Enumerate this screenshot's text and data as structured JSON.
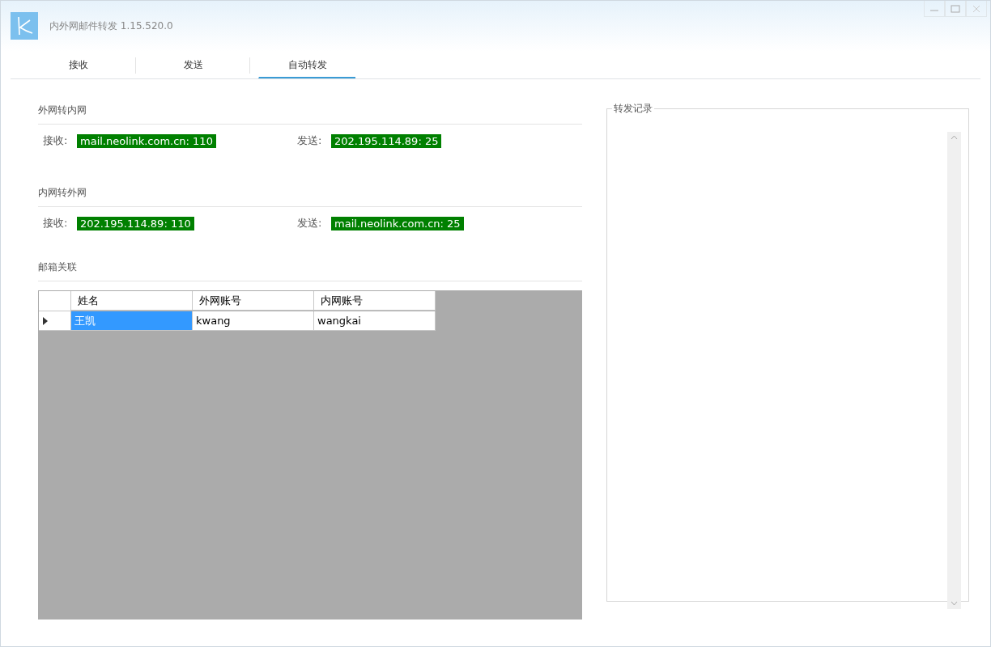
{
  "window": {
    "title": "内外网邮件转发 1.15.520.0"
  },
  "tabs": [
    {
      "label": "接收",
      "selected": false
    },
    {
      "label": "发送",
      "selected": false
    },
    {
      "label": "自动转发",
      "selected": true
    }
  ],
  "routes": [
    {
      "title": "外网转内网",
      "receive_label": "接收:",
      "receive_value": "mail.neolink.com.cn: 110",
      "send_label": "发送:",
      "send_value": "202.195.114.89: 25"
    },
    {
      "title": "内网转外网",
      "receive_label": "接收:",
      "receive_value": "202.195.114.89: 110",
      "send_label": "发送:",
      "send_value": "mail.neolink.com.cn: 25"
    }
  ],
  "mailbox": {
    "title": "邮箱关联",
    "columns": [
      "姓名",
      "外网账号",
      "内网账号"
    ],
    "rows": [
      {
        "current": true,
        "cells": [
          {
            "text": "王凯",
            "selected": true
          },
          {
            "text": "kwang",
            "selected": false
          },
          {
            "text": "wangkai",
            "selected": false
          }
        ]
      }
    ]
  },
  "log": {
    "title": "转发记录"
  }
}
